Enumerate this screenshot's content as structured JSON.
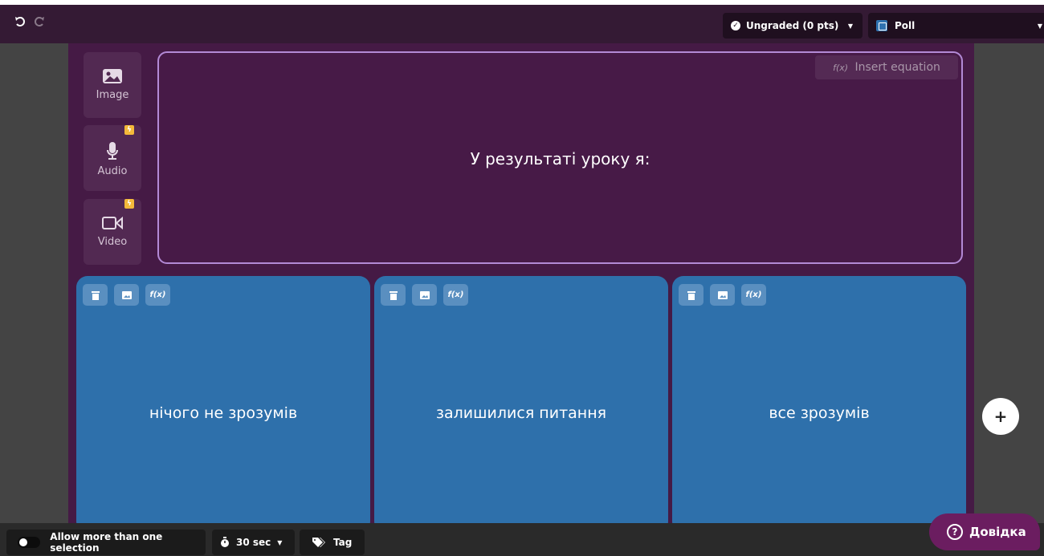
{
  "toolbar": {
    "undo_icon": "undo-icon",
    "redo_icon": "redo-icon",
    "grading": "Ungraded (0 pts)",
    "question_type": "Poll"
  },
  "media": {
    "image_label": "Image",
    "audio_label": "Audio",
    "video_label": "Video"
  },
  "question": {
    "insert_equation": "Insert equation",
    "equation_glyph": "f(x)",
    "text": "У результаті уроку я:"
  },
  "options": [
    {
      "text": "нічого не зрозумів"
    },
    {
      "text": "залишилися питання"
    },
    {
      "text": "все зрозумів"
    }
  ],
  "option_tools": {
    "delete_icon": "trash-icon",
    "image_icon": "image-icon",
    "equation_glyph": "f(x)"
  },
  "add_option_label": "+",
  "bottom": {
    "multi_select_label": "Allow more than one selection",
    "timer_label": "30 sec",
    "tag_label": "Tag"
  },
  "help": {
    "label": "Довідка"
  },
  "colors": {
    "toolbar_bg": "#341a34",
    "editor_bg": "#451a45",
    "question_border": "#b38ad6",
    "option_bg": "#2e70ab",
    "help_bg": "#6b1d60",
    "bolt": "#f4b93a"
  }
}
